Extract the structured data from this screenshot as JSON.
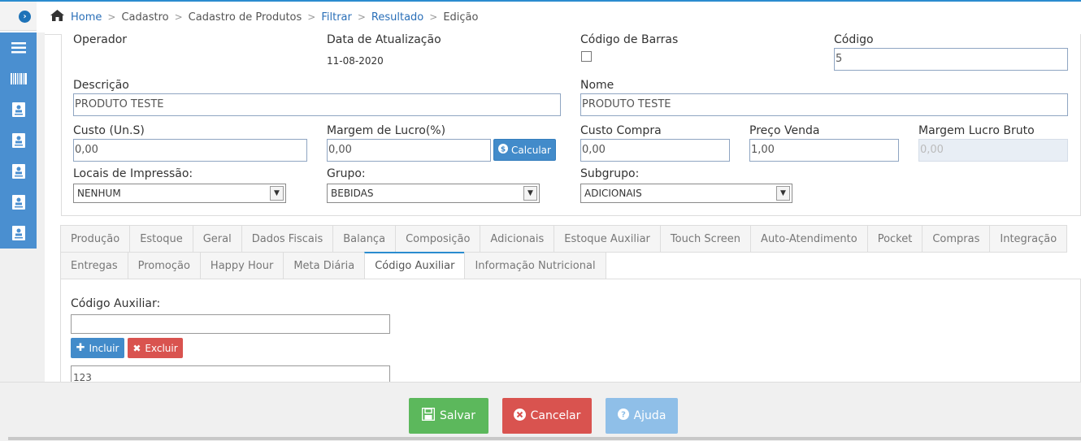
{
  "breadcrumb": {
    "items": [
      {
        "label": "Home"
      },
      {
        "label": "Cadastro"
      },
      {
        "label": "Cadastro de Produtos"
      },
      {
        "label": "Filtrar"
      },
      {
        "label": "Resultado"
      },
      {
        "label": "Edição"
      }
    ]
  },
  "sidebar": {
    "icons": [
      "menu-icon",
      "barcode-icon",
      "contact-card-icon",
      "contact-card-icon",
      "contact-card-icon",
      "contact-card-icon",
      "contact-card-icon"
    ]
  },
  "form": {
    "operador_label": "Operador",
    "data_atualizacao_label": "Data de Atualização",
    "data_atualizacao_value": "11-08-2020",
    "codigo_barras_label": "Código de Barras",
    "codigo_label": "Código",
    "codigo_value": "5",
    "descricao_label": "Descrição",
    "descricao_value": "PRODUTO TESTE",
    "nome_label": "Nome",
    "nome_value": "PRODUTO TESTE",
    "custo_label": "Custo (Un.S)",
    "custo_value": "0,00",
    "margem_label": "Margem de Lucro(%)",
    "margem_value": "0,00",
    "calcular_label": "Calcular",
    "custo_compra_label": "Custo Compra",
    "custo_compra_value": "0,00",
    "preco_venda_label": "Preço Venda",
    "preco_venda_value": "1,00",
    "margem_bruto_label": "Margem Lucro Bruto",
    "margem_bruto_value": "0,00",
    "locais_label": "Locais de Impressão:",
    "locais_value": "NENHUM",
    "grupo_label": "Grupo:",
    "grupo_value": "BEBIDAS",
    "subgrupo_label": "Subgrupo:",
    "subgrupo_value": "ADICIONAIS"
  },
  "tabs": {
    "row1": [
      "Produção",
      "Estoque",
      "Geral",
      "Dados Fiscais",
      "Balança",
      "Composição",
      "Adicionais",
      "Estoque Auxiliar",
      "Touch Screen",
      "Auto-Atendimento",
      "Pocket",
      "Compras",
      "Integração"
    ],
    "row2": [
      "Entregas",
      "Promoção",
      "Happy Hour",
      "Meta Diária",
      "Código Auxiliar",
      "Informação Nutricional"
    ],
    "active": "Código Auxiliar"
  },
  "codigo_auxiliar": {
    "label": "Código Auxiliar:",
    "input_value": "",
    "incluir_label": "Incluir",
    "excluir_label": "Excluir",
    "list_first_item": "123"
  },
  "footer": {
    "salvar_label": "Salvar",
    "cancelar_label": "Cancelar",
    "ajuda_label": "Ajuda"
  },
  "colors": {
    "accent": "#2a8ccf",
    "sidebar": "#4a8fd0",
    "salvar": "#5cb85c",
    "cancelar": "#d9534f",
    "ajuda": "#8fbfe8"
  }
}
